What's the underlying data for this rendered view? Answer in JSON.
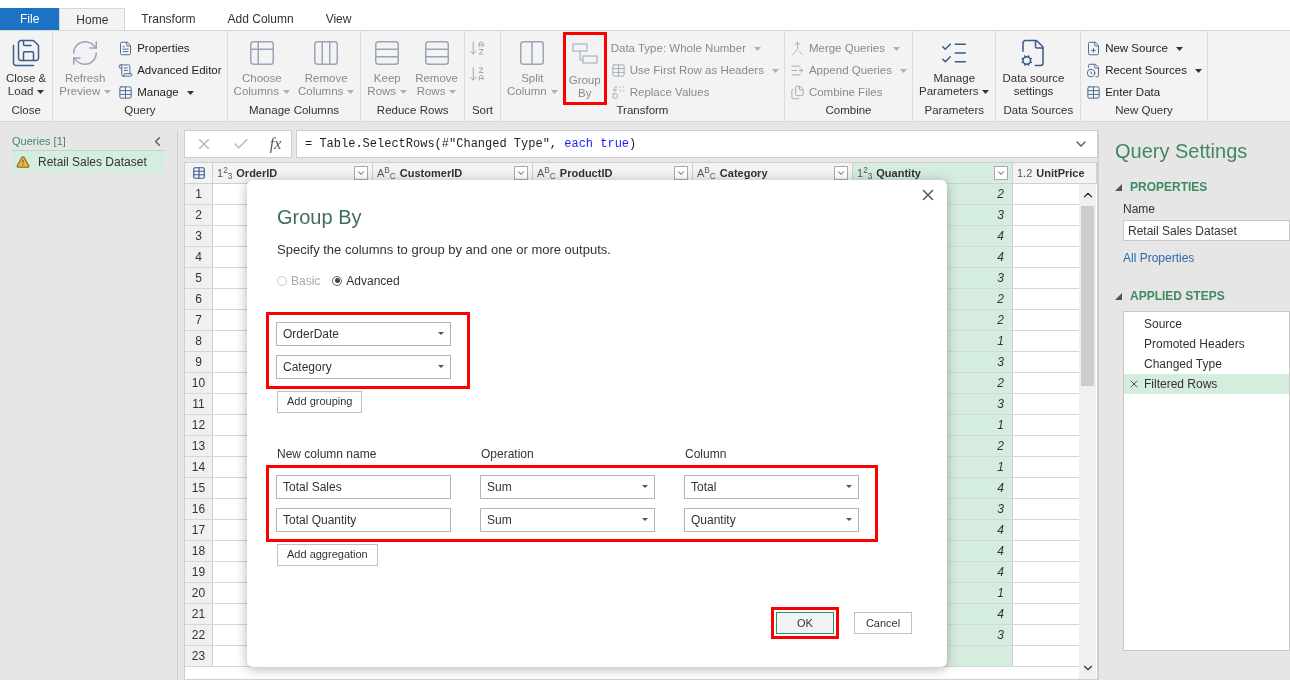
{
  "menu_tabs": [
    {
      "label": "File",
      "kind": "file",
      "selected": false
    },
    {
      "label": "Home",
      "kind": "tab",
      "selected": true
    },
    {
      "label": "Transform",
      "kind": "tab",
      "selected": false
    },
    {
      "label": "Add Column",
      "kind": "tab",
      "selected": false
    },
    {
      "label": "View",
      "kind": "tab",
      "selected": false
    }
  ],
  "ribbon": [
    {
      "label": "Close",
      "items": [
        {
          "kind": "large",
          "lines": [
            "Close &",
            "Load"
          ],
          "dropdown": true,
          "disabled": false,
          "highlighted": false
        }
      ]
    },
    {
      "label": "Query",
      "items": [
        {
          "kind": "large",
          "lines": [
            "Refresh",
            "Preview"
          ],
          "dropdown": true,
          "disabled": true,
          "highlighted": false
        },
        {
          "kind": "stack",
          "rows": [
            {
              "label": "Properties",
              "dropdown": false,
              "disabled": false
            },
            {
              "label": "Advanced Editor",
              "dropdown": false,
              "disabled": false
            },
            {
              "label": "Manage",
              "dropdown": true,
              "disabled": false
            }
          ]
        }
      ]
    },
    {
      "label": "Manage Columns",
      "items": [
        {
          "kind": "large",
          "lines": [
            "Choose",
            "Columns"
          ],
          "dropdown": true,
          "disabled": true,
          "highlighted": false
        },
        {
          "kind": "large",
          "lines": [
            "Remove",
            "Columns"
          ],
          "dropdown": true,
          "disabled": true,
          "highlighted": false
        }
      ]
    },
    {
      "label": "Reduce Rows",
      "items": [
        {
          "kind": "large",
          "lines": [
            "Keep",
            "Rows"
          ],
          "dropdown": true,
          "disabled": true,
          "highlighted": false
        },
        {
          "kind": "large",
          "lines": [
            "Remove",
            "Rows"
          ],
          "dropdown": true,
          "disabled": true,
          "highlighted": false
        }
      ]
    },
    {
      "label": "Sort",
      "items": [
        {
          "kind": "icons"
        }
      ]
    },
    {
      "label": "Transform",
      "items": [
        {
          "kind": "large",
          "lines": [
            "Split",
            "Column"
          ],
          "dropdown": true,
          "disabled": true,
          "highlighted": false
        },
        {
          "kind": "large",
          "lines": [
            "Group",
            "By"
          ],
          "dropdown": false,
          "disabled": true,
          "highlighted": true
        },
        {
          "kind": "stack",
          "rows": [
            {
              "label": "Data Type: Whole Number",
              "dropdown": true,
              "disabled": true
            },
            {
              "label": "Use First Row as Headers",
              "dropdown": true,
              "disabled": true
            },
            {
              "label": "Replace Values",
              "dropdown": false,
              "disabled": true
            }
          ]
        }
      ]
    },
    {
      "label": "Combine",
      "items": [
        {
          "kind": "stack",
          "rows": [
            {
              "label": "Merge Queries",
              "dropdown": true,
              "disabled": true
            },
            {
              "label": "Append Queries",
              "dropdown": true,
              "disabled": true
            },
            {
              "label": "Combine Files",
              "dropdown": false,
              "disabled": true
            }
          ]
        }
      ]
    },
    {
      "label": "Parameters",
      "items": [
        {
          "kind": "large",
          "lines": [
            "Manage",
            "Parameters"
          ],
          "dropdown": true,
          "disabled": false,
          "highlighted": false
        }
      ]
    },
    {
      "label": "Data Sources",
      "items": [
        {
          "kind": "large",
          "lines": [
            "Data source",
            "settings"
          ],
          "dropdown": false,
          "disabled": false,
          "highlighted": false
        }
      ]
    },
    {
      "label": "New Query",
      "items": [
        {
          "kind": "stack",
          "rows": [
            {
              "label": "New Source",
              "dropdown": true,
              "disabled": false
            },
            {
              "label": "Recent Sources",
              "dropdown": true,
              "disabled": false
            },
            {
              "label": "Enter Data",
              "dropdown": false,
              "disabled": false
            }
          ]
        }
      ]
    }
  ],
  "queries_panel": {
    "title": "Queries [1]",
    "items": [
      {
        "label": "Retail Sales Dataset",
        "selected": true
      }
    ]
  },
  "formula_bar": {
    "fx": "fx",
    "parts": [
      {
        "text": "= Table.SelectRows(#\"Changed Type\", ",
        "kind": "plain"
      },
      {
        "text": "each true",
        "kind": "keyword"
      },
      {
        "text": ")",
        "kind": "plain"
      }
    ]
  },
  "table": {
    "columns": [
      {
        "type": "1$^{2}$$_{3}$",
        "name": "OrderID",
        "selected": false,
        "filter": true
      },
      {
        "type": "A$^{B}$$_{C}$",
        "name": "CustomerID",
        "selected": false,
        "filter": true
      },
      {
        "type": "A$^{B}$$_{C}$",
        "name": "ProductID",
        "selected": false,
        "filter": true
      },
      {
        "type": "A$^{B}$$_{C}$",
        "name": "Category",
        "selected": false,
        "filter": true
      },
      {
        "type": "1$^{2}$$_{3}$",
        "name": "Quantity",
        "selected": true,
        "filter": true
      },
      {
        "type": "1.2",
        "name": "UnitPrice",
        "selected": false,
        "filter": false
      }
    ],
    "row_numbers": [
      "1",
      "2",
      "3",
      "4",
      "5",
      "6",
      "7",
      "8",
      "9",
      "10",
      "11",
      "12",
      "13",
      "14",
      "15",
      "16",
      "17",
      "18",
      "19",
      "20",
      "21",
      "22",
      "23"
    ],
    "quantity_values": [
      "2",
      "3",
      "4",
      "4",
      "3",
      "2",
      "2",
      "1",
      "3",
      "2",
      "3",
      "1",
      "2",
      "1",
      "4",
      "3",
      "4",
      "4",
      "4",
      "1",
      "4",
      "3"
    ]
  },
  "dialog": {
    "title": "Group By",
    "subtitle": "Specify the columns to group by and one or more outputs.",
    "modes": [
      {
        "label": "Basic",
        "selected": false,
        "disabled": true
      },
      {
        "label": "Advanced",
        "selected": true,
        "disabled": false
      }
    ],
    "groupings": [
      "OrderDate",
      "Category"
    ],
    "groupings_highlighted": true,
    "add_grouping": "Add grouping",
    "aggregation_headers": [
      "New column name",
      "Operation",
      "Column"
    ],
    "aggregations": [
      {
        "name": "Total Sales",
        "operation": "Sum",
        "column": "Total"
      },
      {
        "name": "Total Quantity",
        "operation": "Sum",
        "column": "Quantity"
      }
    ],
    "aggregations_highlighted": true,
    "add_aggregation": "Add aggregation",
    "buttons": [
      {
        "label": "OK",
        "kind": "primary",
        "highlighted": true
      },
      {
        "label": "Cancel",
        "kind": "secondary",
        "highlighted": false
      }
    ]
  },
  "query_settings": {
    "title": "Query Settings",
    "properties": {
      "heading": "PROPERTIES",
      "expanded": true,
      "name_label": "Name",
      "name_value": "Retail Sales Dataset",
      "link": "All Properties"
    },
    "applied_steps": {
      "heading": "APPLIED STEPS",
      "expanded": true,
      "steps": [
        {
          "label": "Source",
          "selected": false
        },
        {
          "label": "Promoted Headers",
          "selected": false
        },
        {
          "label": "Changed Type",
          "selected": false
        },
        {
          "label": "Filtered Rows",
          "selected": true
        }
      ]
    }
  }
}
